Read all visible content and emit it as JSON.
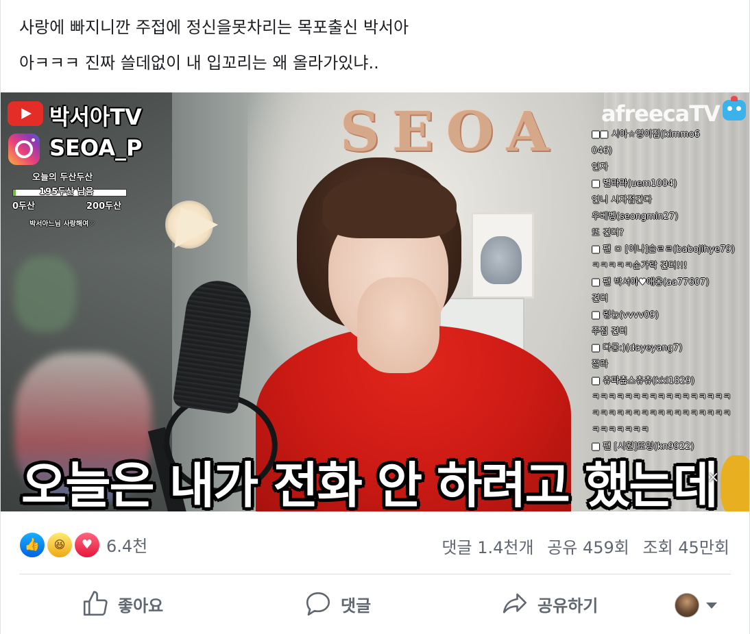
{
  "post": {
    "caption_lines": [
      "사랑에 빠지니깐 주접에 정신을못차리는 목포출신 박서아",
      "아ㅋㅋㅋ 진짜 쓸데없이 내 입꼬리는 왜 올라가있냐.."
    ]
  },
  "video": {
    "channel_youtube": "박서아TV",
    "channel_instagram": "SEOA_P",
    "goal_title": "오늘의 두산두산",
    "goal_remaining": "195두산 남음",
    "goal_min": "0두산",
    "goal_max": "200두산",
    "goal_progress": 0.025,
    "small_caption": "박서아느님 사랑해여♡",
    "balloons": "SEOA",
    "watermark": "afreecaTV",
    "subtitle": "오늘은 내가 전화 안 하려고 했는데",
    "close_glyph": "×",
    "chat": [
      "■■ 시아☆영이집(kimmo6",
      "046)",
      "인자",
      "■ 별라라(uem1004)",
      "언니 시자접간다",
      "우베벵(seongmin27)",
      "또 견더?",
      "■ 팬 ㅁ [이나]슬ㄹㄹ(babojihye79)",
      "ㅋㅋㅋㅋㅋ손가락 견더!!!",
      "■ 팬 박서아♥애옹(aa77607)",
      "견더",
      "■ 링늉(vvvv09)",
      "주접 견더",
      "■ 다롱:)(dayeyang7)",
      "잘라",
      "■ 츄파춥스츄츄(kki1829)",
      "ㅋㅋㅋㅋㅋㅋㅋㅋㅋㅋㅋㅋㅋㅋㅋㅋㅋ",
      "ㅋㅋㅋㅋㅋㅋㅋㅋㅋㅋㅋㅋㅋㅋㅋㅋㅋ",
      "ㅋㅋㅋㅋㅋㅋㅋ",
      "■ 팬 [시원]또잉(kn9922)"
    ]
  },
  "reactions": {
    "icons": [
      "like-icon",
      "haha-icon",
      "love-icon"
    ],
    "count": "6.4천",
    "comments": "댓글 1.4천개",
    "shares": "공유 459회",
    "views": "조회 45만회"
  },
  "actions": {
    "like": "좋아요",
    "comment": "댓글",
    "share": "공유하기"
  },
  "colors": {
    "like_blue": "#1877f2",
    "text_secondary": "#606770",
    "divider": "#dadde1"
  }
}
